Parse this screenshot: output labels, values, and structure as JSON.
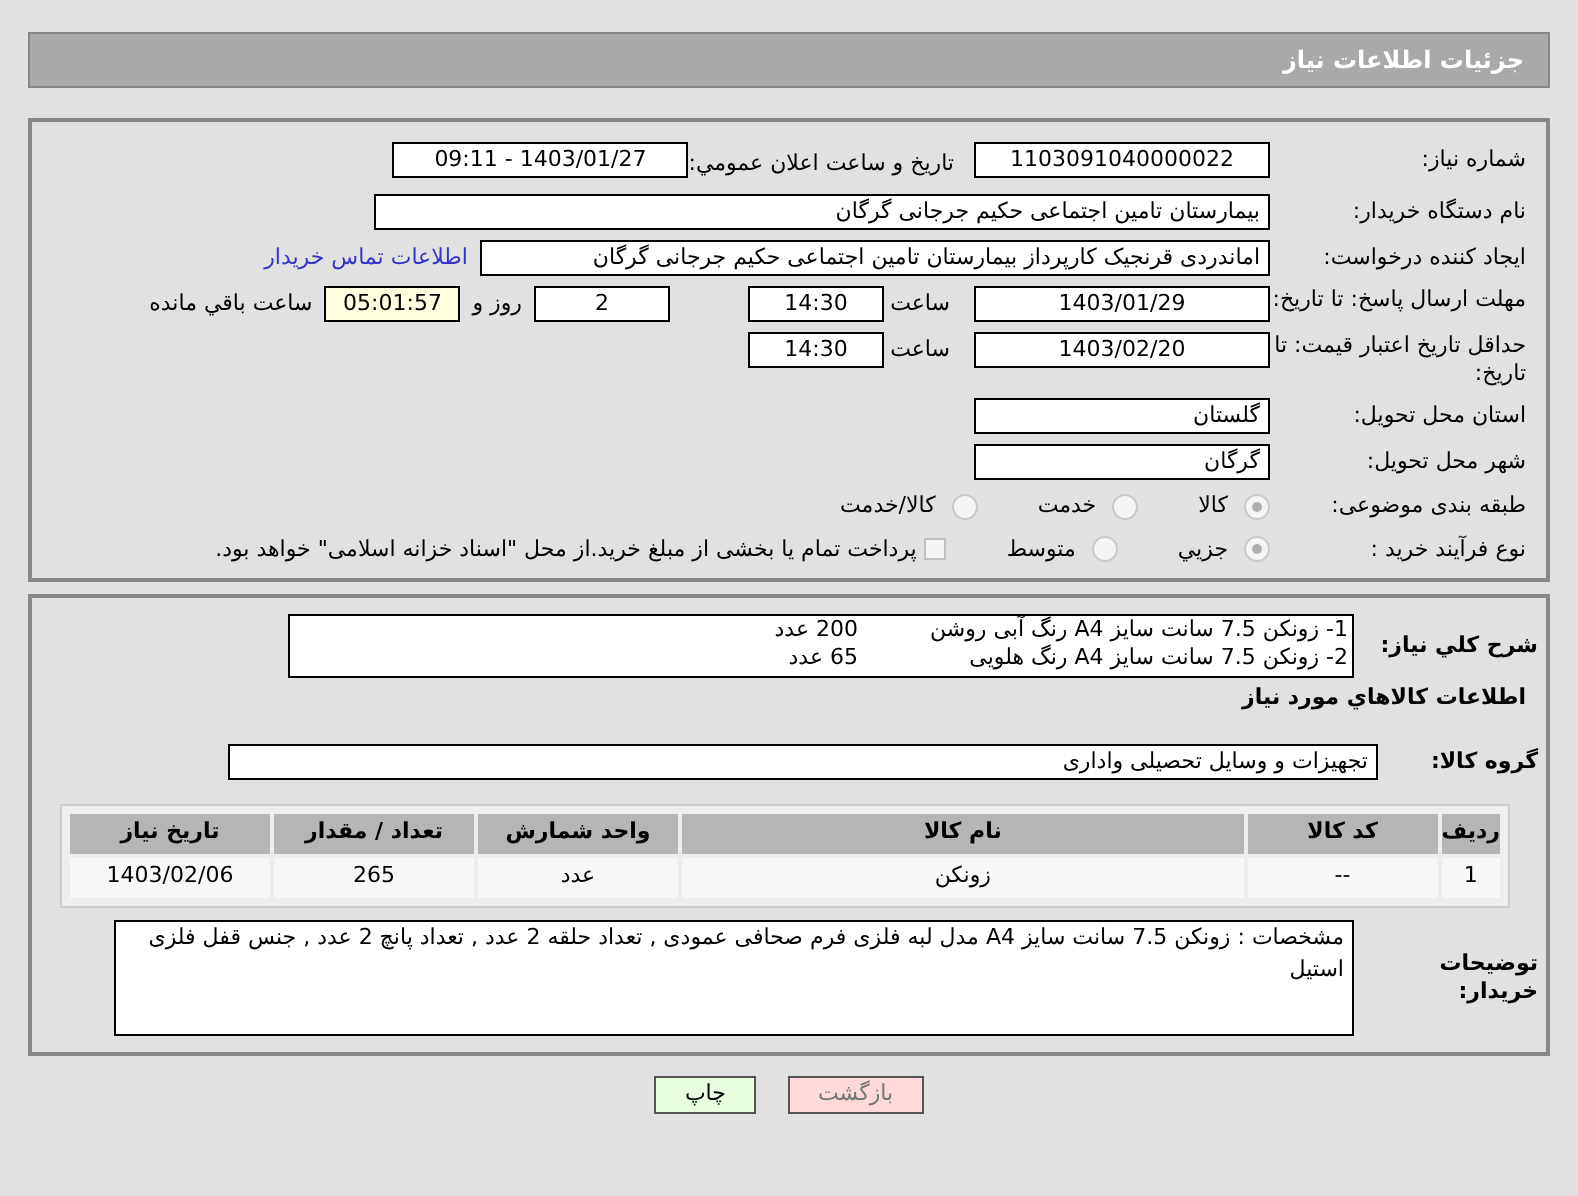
{
  "header": {
    "title": "جزئیات اطلاعات نیاز"
  },
  "info": {
    "need_number": {
      "label": "شماره نیاز:",
      "value": "1103091040000022"
    },
    "announce": {
      "label": "تاریخ و ساعت اعلان عمومي:",
      "value": "1403/01/27 - 09:11"
    },
    "buyer": {
      "label": "نام دستگاه خریدار:",
      "value": "بیمارستان تامین اجتماعی حکیم جرجانی گرگان"
    },
    "creator": {
      "label": "ایجاد کننده درخواست:",
      "value": "اماندردی قرنجیک کارپرداز بیمارستان تامین اجتماعی حکیم جرجانی گرگان",
      "link": "اطلاعات تماس خریدار"
    },
    "deadline": {
      "label": "مهلت ارسال پاسخ: تا تاریخ:",
      "date": "1403/01/29",
      "time_label": "ساعت",
      "time": "14:30",
      "days": "2",
      "days_label": "روز و",
      "remaining": "05:01:57",
      "remaining_label": "ساعت باقي مانده"
    },
    "validity": {
      "label": "حداقل تاریخ اعتبار قیمت: تا تاریخ:",
      "date": "1403/02/20",
      "time_label": "ساعت",
      "time": "14:30"
    },
    "province": {
      "label": "استان محل تحویل:",
      "value": "گلستان"
    },
    "city": {
      "label": "شهر محل تحویل:",
      "value": "گرگان"
    },
    "category": {
      "label": "طبقه بندی موضوعی:",
      "options": [
        {
          "label": "کالا",
          "selected": true
        },
        {
          "label": "خدمت",
          "selected": false
        },
        {
          "label": "کالا/خدمت",
          "selected": false
        }
      ]
    },
    "process": {
      "label": "نوع فرآیند خرید :",
      "options": [
        {
          "label": "جزيي",
          "selected": true
        },
        {
          "label": "متوسط",
          "selected": false
        }
      ],
      "payment": {
        "checked": false,
        "text": "پرداخت تمام یا بخشی از مبلغ خرید.از محل \"اسناد خزانه اسلامی\" خواهد بود."
      }
    }
  },
  "details": {
    "summary": {
      "label": "شرح کلي نياز:",
      "lines": [
        {
          "text": "1- زونکن 7.5 سانت سایز A4 رنگ آبی روشن",
          "qty": "200 عدد"
        },
        {
          "text": "2- زونکن 7.5 سانت سایز A4  رنگ هلویی",
          "qty": "65 عدد"
        }
      ]
    },
    "goods_heading": "اطلاعات کالاهاي مورد نياز",
    "group": {
      "label": "گروه کالا:",
      "value": "تجهیزات و وسایل تحصیلی واداری"
    },
    "table": {
      "columns": [
        "رديف",
        "کد کالا",
        "نام کالا",
        "واحد شمارش",
        "تعداد / مقدار",
        "تاریخ نیاز"
      ],
      "rows": [
        [
          "1",
          "--",
          "زونکن",
          "عدد",
          "265",
          "1403/02/06"
        ]
      ]
    },
    "notes": {
      "label": "توضیحات خریدار:",
      "value": "مشخصات : زونکن 7.5 سانت سایز A4 مدل لبه فلزی فرم صحافی عمودی , تعداد حلقه 2 عدد , تعداد پانچ 2 عدد , جنس قفل فلزی استیل"
    }
  },
  "buttons": [
    {
      "label": "بازگشت",
      "kind": "back"
    },
    {
      "label": "چاپ",
      "kind": "print"
    }
  ]
}
